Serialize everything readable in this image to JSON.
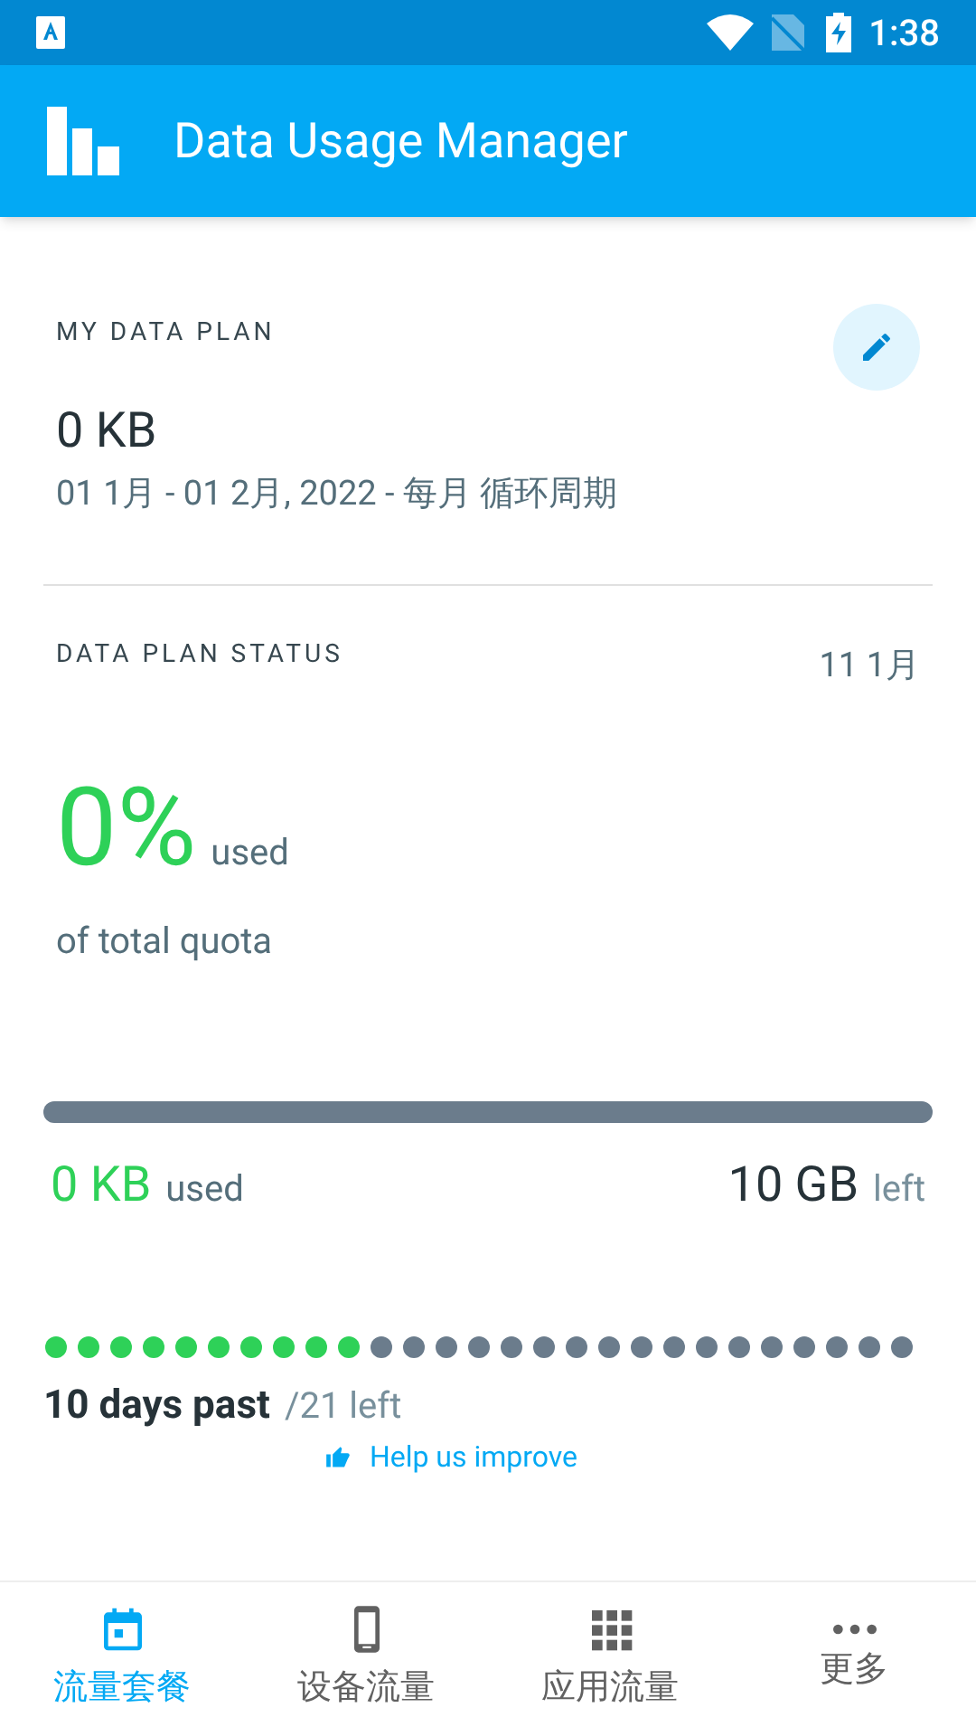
{
  "status_bar": {
    "time": "1:38"
  },
  "app_bar": {
    "title": "Data Usage Manager"
  },
  "plan": {
    "heading": "MY DATA PLAN",
    "amount": "0 KB",
    "period": "01 1月 - 01 2月, 2022 - 每月 循环周期"
  },
  "status": {
    "heading": "DATA PLAN STATUS",
    "date": "11 1月",
    "percent": "0%",
    "percent_suffix": "used",
    "caption": "of total quota",
    "level": 0,
    "used_value": "0 KB",
    "used_label": "used",
    "left_value": "10 GB",
    "left_label": "left"
  },
  "days": [
    {
      "past": true
    },
    {
      "past": true
    },
    {
      "past": true
    },
    {
      "past": true
    },
    {
      "past": true
    },
    {
      "past": true
    },
    {
      "past": true
    },
    {
      "past": true
    },
    {
      "past": true
    },
    {
      "past": true
    },
    {
      "past": false
    },
    {
      "past": false
    },
    {
      "past": false
    },
    {
      "past": false
    },
    {
      "past": false
    },
    {
      "past": false
    },
    {
      "past": false
    },
    {
      "past": false
    },
    {
      "past": false
    },
    {
      "past": false
    },
    {
      "past": false
    },
    {
      "past": false
    },
    {
      "past": false
    },
    {
      "past": false
    },
    {
      "past": false
    },
    {
      "past": false
    },
    {
      "past": false
    }
  ],
  "days_text": {
    "past": "10 days past",
    "left": "/21 left"
  },
  "feedback": {
    "label": "Help us improve"
  },
  "bottom_nav": [
    {
      "kind": "calendar",
      "label": "流量套餐",
      "selected": true
    },
    {
      "kind": "phone",
      "label": "设备流量",
      "selected": false
    },
    {
      "kind": "grid",
      "label": "应用流量",
      "selected": false
    },
    {
      "kind": "more",
      "label": "更多",
      "selected": false
    }
  ]
}
